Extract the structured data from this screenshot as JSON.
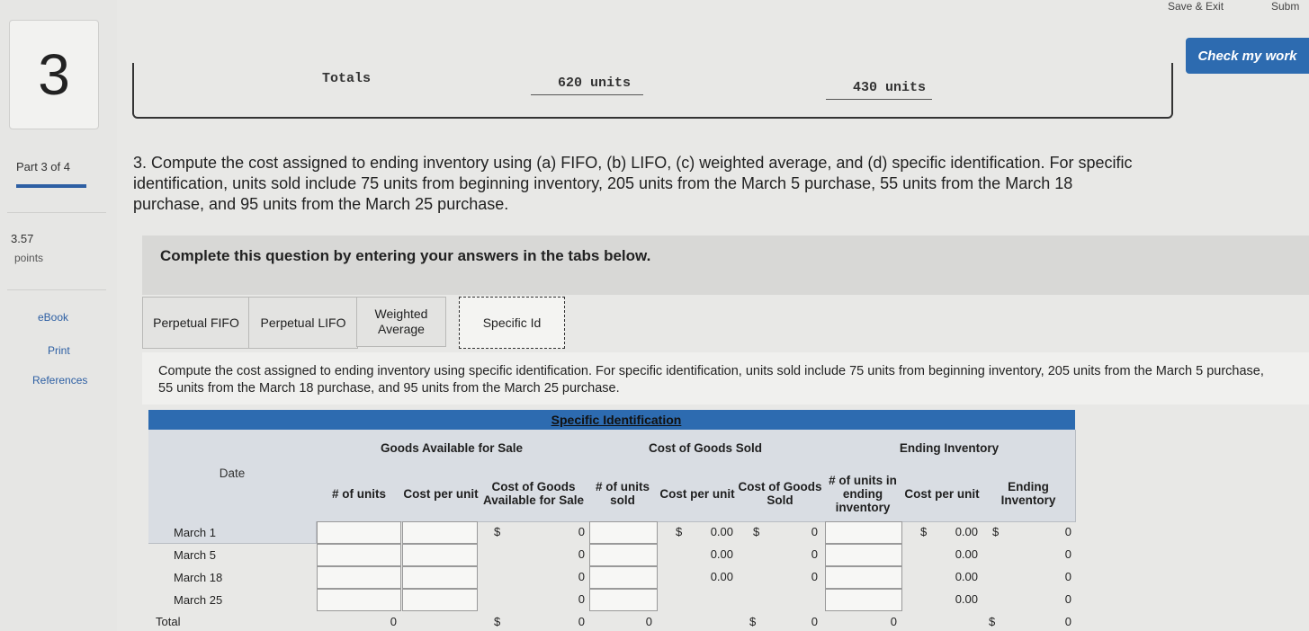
{
  "rail": {
    "question_number": "3",
    "part": "Part 3 of 4",
    "points_value": "3.57",
    "points_label": "points",
    "links": [
      "eBook",
      "Print",
      "References"
    ]
  },
  "topbar": {
    "save_exit": "Save & Exit",
    "submit": "Subm",
    "check": "Check my work"
  },
  "totals_row": {
    "label": "Totals",
    "units_a": "620 units",
    "units_b": "430 units"
  },
  "question": "3. Compute the cost assigned to ending inventory using (a) FIFO, (b) LIFO, (c) weighted average, and (d) specific identification. For specific identification, units sold include 75 units from beginning inventory, 205 units from the March 5 purchase, 55 units from the March 18 purchase, and 95 units from the March 25 purchase.",
  "instruction": "Complete this question by entering your answers in the tabs below.",
  "tabs": [
    "Perpetual FIFO",
    "Perpetual LIFO",
    "Weighted Average",
    "Specific Id"
  ],
  "subquestion": "Compute the cost assigned to ending inventory using specific identification. For specific identification, units sold include 75 units from beginning inventory, 205 units from the March 5 purchase, 55 units from the March 18 purchase, and 95 units from the March 25 purchase.",
  "table": {
    "title": "Specific Identification",
    "groups": {
      "gafs": "Goods Available for Sale",
      "cogs": "Cost of Goods Sold",
      "ending": "Ending Inventory"
    },
    "headers": {
      "date": "Date",
      "units": "# of units",
      "cpu": "Cost per unit",
      "cgafs": "Cost of Goods Available for Sale",
      "units_sold": "# of units sold",
      "cogs_cpu": "Cost per unit",
      "cogs": "Cost of Goods Sold",
      "end_units": "# of units in ending inventory",
      "end_cpu": "Cost per unit",
      "end_inv": "Ending Inventory"
    },
    "rows": [
      {
        "date": "March 1",
        "cgafs": "0",
        "cogs_cpu": "0.00",
        "cogs": "0",
        "end_cpu": "0.00",
        "end_inv": "0"
      },
      {
        "date": "March 5",
        "cgafs": "0",
        "cogs_cpu": "0.00",
        "cogs": "0",
        "end_cpu": "0.00",
        "end_inv": "0"
      },
      {
        "date": "March 18",
        "cgafs": "0",
        "cogs_cpu": "0.00",
        "cogs": "0",
        "end_cpu": "0.00",
        "end_inv": "0"
      },
      {
        "date": "March 25",
        "cgafs": "0",
        "end_cpu": "0.00",
        "end_inv": "0"
      }
    ],
    "total": {
      "label": "Total",
      "units": "0",
      "cgafs": "0",
      "units_sold": "0",
      "cogs": "0",
      "end_units": "0",
      "end_inv": "0"
    },
    "currency": "$"
  }
}
